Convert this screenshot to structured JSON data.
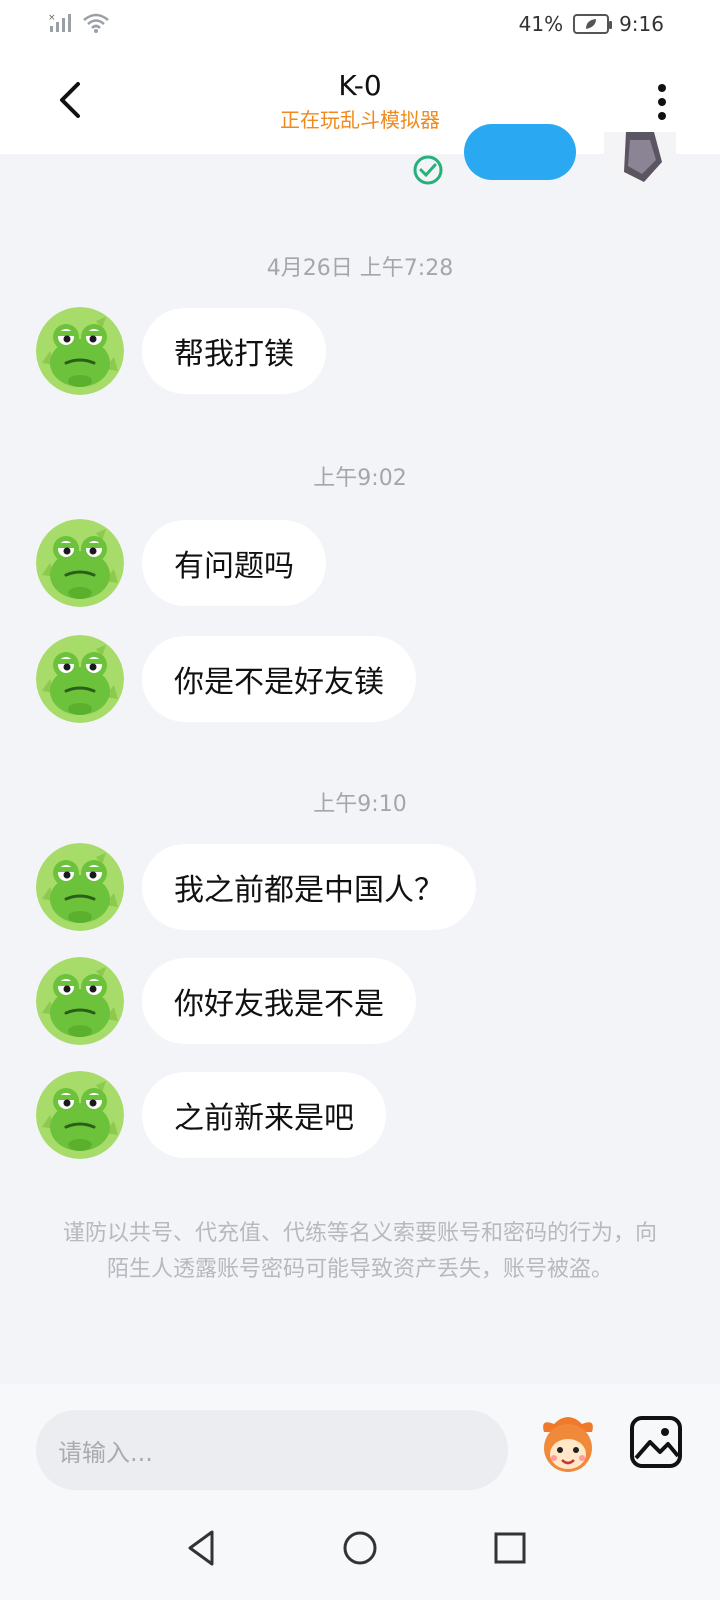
{
  "status_bar": {
    "battery": "41%",
    "time": "9:16"
  },
  "header": {
    "title": "K-0",
    "subtitle": "正在玩乱斗模拟器"
  },
  "messages": [
    {
      "type": "time",
      "text": "4月26日 上午7:28"
    },
    {
      "type": "msg",
      "text": "帮我打镁"
    },
    {
      "type": "time",
      "text": "上午9:02"
    },
    {
      "type": "msg",
      "text": "有问题吗"
    },
    {
      "type": "msg",
      "text": "你是不是好友镁"
    },
    {
      "type": "time",
      "text": "上午9:10"
    },
    {
      "type": "msg",
      "text": "我之前都是中国人？"
    },
    {
      "type": "msg",
      "text": "你好友我是不是"
    },
    {
      "type": "msg",
      "text": "之前新来是吧"
    }
  ],
  "warning": "谨防以共号、代充值、代练等名义索要账号和密码的行为，向陌生人透露账号密码可能导致资产丢失，账号被盗。",
  "input": {
    "placeholder": "请输入..."
  },
  "colors": {
    "accent": "#f08a1c",
    "sent_bubble": "#2aa9f2",
    "check": "#27b07a",
    "frog": "#7ccd3f"
  },
  "icons": [
    "signal-icon",
    "wifi-icon",
    "battery-icon",
    "back-icon",
    "more-icon",
    "check-icon",
    "frog-avatar-icon",
    "emoji-mascot-icon",
    "image-icon",
    "nav-back-icon",
    "nav-home-icon",
    "nav-recent-icon"
  ]
}
